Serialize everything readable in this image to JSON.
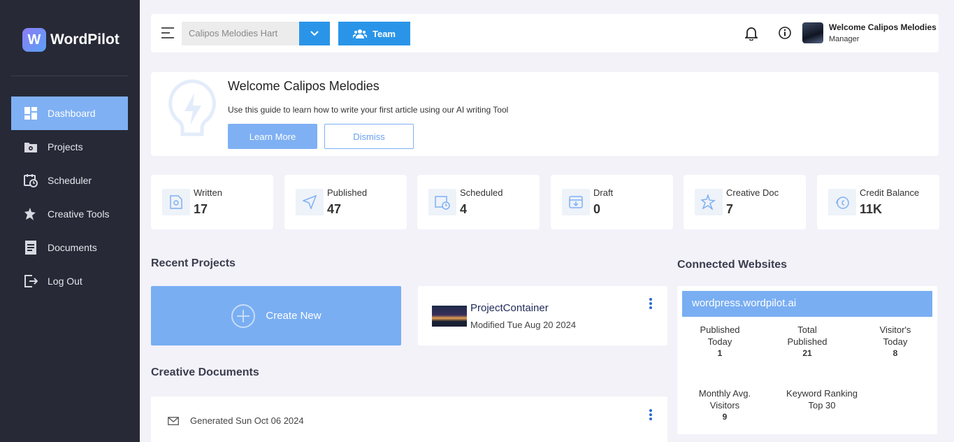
{
  "app": {
    "name": "WordPilot",
    "logo_letter": "W"
  },
  "sidebar": {
    "items": [
      {
        "label": "Dashboard",
        "icon": "dashboard-icon",
        "active": true
      },
      {
        "label": "Projects",
        "icon": "folder-gear-icon"
      },
      {
        "label": "Scheduler",
        "icon": "calendar-clock-icon"
      },
      {
        "label": "Creative Tools",
        "icon": "sparkle-icon"
      },
      {
        "label": "Documents",
        "icon": "document-icon"
      },
      {
        "label": "Log Out",
        "icon": "logout-icon"
      }
    ]
  },
  "topbar": {
    "workspace_select": "Calipos Melodies Hart",
    "team_label": "Team",
    "user_name": "Welcome Calipos Melodies",
    "user_role": "Manager"
  },
  "welcome": {
    "title": "Welcome Calipos Melodies",
    "subtitle": "Use this guide to learn how to write your first article using our AI writing Tool",
    "learn_more": "Learn More",
    "dismiss": "Dismiss"
  },
  "stats": [
    {
      "label": "Written",
      "value": "17",
      "icon": "document-gear-icon"
    },
    {
      "label": "Published",
      "value": "47",
      "icon": "send-icon"
    },
    {
      "label": "Scheduled",
      "value": "4",
      "icon": "calendar-clock-icon"
    },
    {
      "label": "Draft",
      "value": "0",
      "icon": "archive-icon"
    },
    {
      "label": "Creative Doc",
      "value": "7",
      "icon": "sparkle-icon"
    },
    {
      "label": "Credit Balance",
      "value": "11K",
      "icon": "coins-icon"
    }
  ],
  "recent_projects": {
    "title": "Recent Projects",
    "create_new": "Create New",
    "project": {
      "name": "ProjectContainer",
      "modified": "Modified Tue Aug 20 2024"
    }
  },
  "creative_documents": {
    "title": "Creative Documents",
    "doc": {
      "text": "Generated Sun Oct 06 2024"
    }
  },
  "connected_websites": {
    "title": "Connected Websites",
    "site": "wordpress.wordpilot.ai",
    "metrics": [
      {
        "label": "Published Today",
        "value": "1"
      },
      {
        "label": "Total Published",
        "value": "21"
      },
      {
        "label": "Visitor's Today",
        "value": "8"
      },
      {
        "label": "Monthly Avg. Visitors",
        "value": "9"
      },
      {
        "label": "Keyword Ranking Top 30",
        "value": ""
      }
    ]
  },
  "colors": {
    "sidebar": "#272936",
    "accent": "#2a95e8",
    "light_accent": "#79aef2"
  }
}
